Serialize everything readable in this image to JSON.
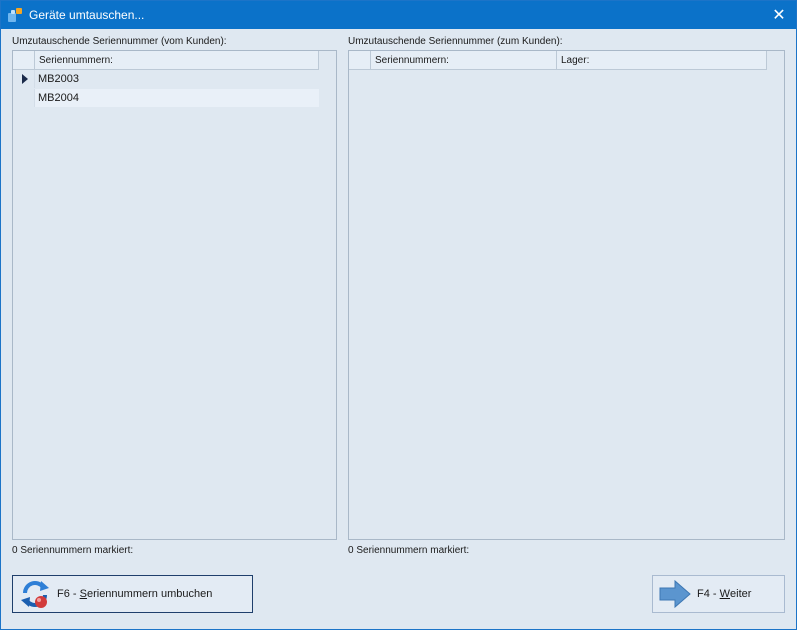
{
  "window": {
    "title": "Geräte umtauschen...",
    "close_glyph": "✕"
  },
  "left_panel": {
    "caption": "Umzutauschende Seriennummer (vom Kunden):",
    "columns": [
      "Seriennummern:"
    ],
    "rows": [
      "MB2003",
      "MB2004"
    ],
    "status": "0 Seriennummern markiert:"
  },
  "right_panel": {
    "caption": "Umzutauschende Seriennummer (zum Kunden):",
    "columns": [
      "Seriennummern:",
      "Lager:"
    ],
    "rows": [],
    "status": "0 Seriennummern markiert:"
  },
  "buttons": {
    "rebook": {
      "prefix": "F6 - ",
      "mnemonic": "S",
      "rest": "eriennummern umbuchen",
      "icon": "rebook-refresh-icon"
    },
    "next": {
      "prefix": "F4 - ",
      "mnemonic": "W",
      "rest": "eiter",
      "icon": "arrow-right-icon"
    }
  },
  "colors": {
    "titlebar": "#0b72c9",
    "window_bg": "#dfe8f1",
    "border": "#a9b8c8"
  }
}
